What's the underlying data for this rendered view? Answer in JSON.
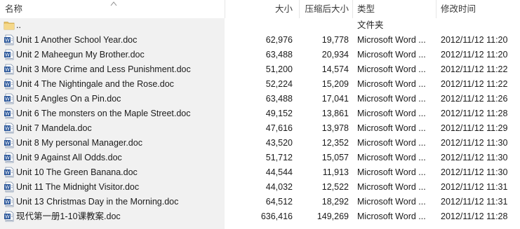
{
  "header": {
    "name": "名称",
    "size": "大小",
    "compressed": "压缩后大小",
    "type": "类型",
    "modified": "修改时间"
  },
  "rows": [
    {
      "name": "..",
      "size": "",
      "compressed": "",
      "type": "文件夹",
      "modified": "",
      "icon": "folder-icon"
    },
    {
      "name": "Unit 1  Another School Year.doc",
      "size": "62,976",
      "compressed": "19,778",
      "type": "Microsoft Word ...",
      "modified": "2012/11/12 11:20",
      "icon": "word-doc-icon"
    },
    {
      "name": "Unit 2  Maheegun My Brother.doc",
      "size": "63,488",
      "compressed": "20,934",
      "type": "Microsoft Word ...",
      "modified": "2012/11/12 11:20",
      "icon": "word-doc-icon"
    },
    {
      "name": "Unit 3 More Crime and Less Punishment.doc",
      "size": "51,200",
      "compressed": "14,574",
      "type": "Microsoft Word ...",
      "modified": "2012/11/12 11:22",
      "icon": "word-doc-icon"
    },
    {
      "name": "Unit 4 The Nightingale and the Rose.doc",
      "size": "52,224",
      "compressed": "15,209",
      "type": "Microsoft Word ...",
      "modified": "2012/11/12 11:22",
      "icon": "word-doc-icon"
    },
    {
      "name": "Unit 5  Angles On a Pin.doc",
      "size": "63,488",
      "compressed": "17,041",
      "type": "Microsoft Word ...",
      "modified": "2012/11/12 11:26",
      "icon": "word-doc-icon"
    },
    {
      "name": "Unit 6  The monsters on the Maple Street.doc",
      "size": "49,152",
      "compressed": "13,861",
      "type": "Microsoft Word ...",
      "modified": "2012/11/12 11:28",
      "icon": "word-doc-icon"
    },
    {
      "name": "Unit 7 Mandela.doc",
      "size": "47,616",
      "compressed": "13,978",
      "type": "Microsoft Word ...",
      "modified": "2012/11/12 11:29",
      "icon": "word-doc-icon"
    },
    {
      "name": "Unit 8  My personal Manager.doc",
      "size": "43,520",
      "compressed": "12,352",
      "type": "Microsoft Word ...",
      "modified": "2012/11/12 11:30",
      "icon": "word-doc-icon"
    },
    {
      "name": "Unit 9  Against All Odds.doc",
      "size": "51,712",
      "compressed": "15,057",
      "type": "Microsoft Word ...",
      "modified": "2012/11/12 11:30",
      "icon": "word-doc-icon"
    },
    {
      "name": "Unit 10  The Green Banana.doc",
      "size": "44,544",
      "compressed": "11,913",
      "type": "Microsoft Word ...",
      "modified": "2012/11/12 11:30",
      "icon": "word-doc-icon"
    },
    {
      "name": "Unit 11  The Midnight Visitor.doc",
      "size": "44,032",
      "compressed": "12,522",
      "type": "Microsoft Word ...",
      "modified": "2012/11/12 11:31",
      "icon": "word-doc-icon"
    },
    {
      "name": "Unit 13 Christmas Day in the Morning.doc",
      "size": "64,512",
      "compressed": "18,292",
      "type": "Microsoft Word ...",
      "modified": "2012/11/12 11:31",
      "icon": "word-doc-icon"
    },
    {
      "name": "现代第一册1-10课教案.doc",
      "size": "636,416",
      "compressed": "149,269",
      "type": "Microsoft Word ...",
      "modified": "2012/11/12 11:28",
      "icon": "word-doc-icon"
    }
  ]
}
